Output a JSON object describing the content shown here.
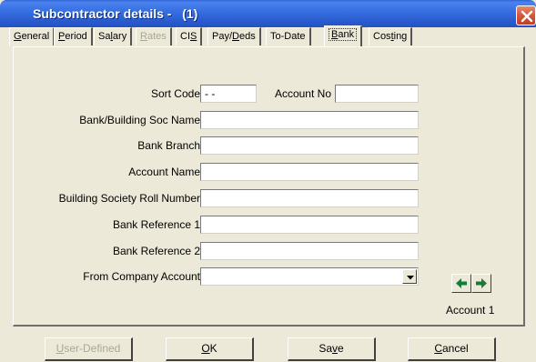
{
  "window": {
    "title": "Subcontractor details -   (1)"
  },
  "tabs": [
    {
      "label": "General",
      "mnemonic_index": 0,
      "state": "normal"
    },
    {
      "label": "Period",
      "mnemonic_index": 0,
      "state": "normal"
    },
    {
      "label": "Salary",
      "mnemonic_index": 2,
      "state": "normal"
    },
    {
      "label": "Rates",
      "mnemonic_index": 0,
      "state": "disabled"
    },
    {
      "label": "CIS",
      "mnemonic_index": 2,
      "state": "normal"
    },
    {
      "label": "Pay/Deds",
      "mnemonic_index": 4,
      "state": "normal"
    },
    {
      "label": "To-Date",
      "mnemonic_index": -1,
      "state": "normal"
    },
    {
      "label": "Bank",
      "mnemonic_index": 0,
      "state": "active"
    },
    {
      "label": "Costing",
      "mnemonic_index": 3,
      "state": "normal"
    }
  ],
  "form": {
    "sort_code": {
      "label": "Sort Code",
      "value": " - -"
    },
    "account_no": {
      "label": "Account No",
      "value": ""
    },
    "bank_name": {
      "label": "Bank/Building Soc Name",
      "value": ""
    },
    "bank_branch": {
      "label": "Bank Branch",
      "value": ""
    },
    "account_name": {
      "label": "Account Name",
      "value": ""
    },
    "roll_number": {
      "label": "Building Society Roll Number",
      "value": ""
    },
    "bank_ref_1": {
      "label": "Bank Reference 1",
      "value": ""
    },
    "bank_ref_2": {
      "label": "Bank Reference 2",
      "value": ""
    },
    "from_company_account": {
      "label": "From Company Account",
      "value": ""
    }
  },
  "account_nav": {
    "caption": "Account 1",
    "prev_icon": "arrow-left-icon",
    "next_icon": "arrow-right-icon",
    "arrow_color": "#1a7a3a"
  },
  "buttons": {
    "user_defined": "User-Defined",
    "ok": "OK",
    "save": "Save",
    "cancel": "Cancel"
  },
  "colors": {
    "titlebar": "#2a5cd0",
    "close": "#d4573a",
    "face": "#ece9d8"
  }
}
